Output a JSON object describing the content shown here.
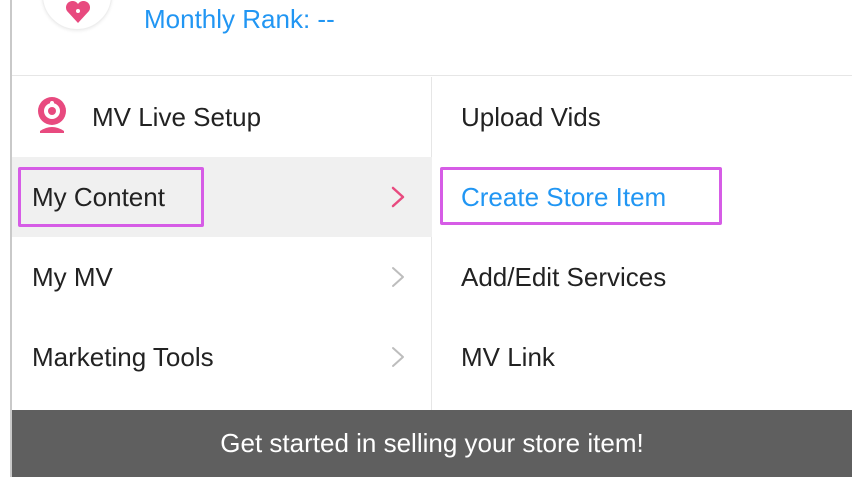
{
  "header": {
    "rank_label": "Monthly Rank: --",
    "avatar_icon": "heart-icon"
  },
  "menu": {
    "items": [
      {
        "label": "MV Live Setup",
        "icon": "webcam-icon",
        "has_chevron": false,
        "active": false
      },
      {
        "label": "My Content",
        "has_chevron": true,
        "active": true
      },
      {
        "label": "My MV",
        "has_chevron": true,
        "active": false
      },
      {
        "label": "Marketing Tools",
        "has_chevron": true,
        "active": false
      }
    ]
  },
  "submenu": {
    "items": [
      {
        "label": "Upload Vids",
        "selected": false
      },
      {
        "label": "Create Store Item",
        "selected": true
      },
      {
        "label": "Add/Edit Services",
        "selected": false
      },
      {
        "label": "MV Link",
        "selected": false
      }
    ]
  },
  "banner": {
    "text": "Get started in selling your store item!"
  },
  "colors": {
    "accent_blue": "#2196f3",
    "accent_pink": "#e84a7f",
    "highlight_purple": "#d65ce6",
    "banner_bg": "#5f5f5f"
  }
}
